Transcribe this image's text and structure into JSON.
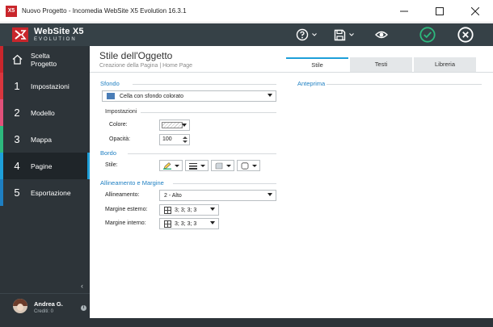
{
  "window": {
    "title": "Nuovo Progetto - Incomedia WebSite X5 Evolution 16.3.1",
    "app_icon_text": "X5"
  },
  "header": {
    "logo_line1": "WebSite X5",
    "logo_line2": "EVOLUTION",
    "accent_color": "#c9262c",
    "ok_color": "#2db87d",
    "buttons": [
      "help-icon",
      "save-icon",
      "preview-icon",
      "confirm-icon",
      "close-icon"
    ]
  },
  "sidebar": {
    "items": [
      {
        "number": "",
        "icon": "home-icon",
        "label": "Scelta Progetto",
        "label_l1": "Scelta",
        "label_l2": "Progetto",
        "color": "#c9262c"
      },
      {
        "number": "1",
        "label": "Impostazioni",
        "color": "#d9363e"
      },
      {
        "number": "2",
        "label": "Modello",
        "color": "#e0517a"
      },
      {
        "number": "3",
        "label": "Mappa",
        "color": "#2db87d"
      },
      {
        "number": "4",
        "label": "Pagine",
        "color": "#1e9fd9",
        "active": true
      },
      {
        "number": "5",
        "label": "Esportazione",
        "color": "#1e7fc2"
      }
    ],
    "user": {
      "name": "Andrea G.",
      "credits": "Crediti: 0"
    }
  },
  "page": {
    "title": "Stile dell'Oggetto",
    "subtitle": "Creazione della Pagina | Home Page"
  },
  "tabs": [
    {
      "label": "Stile",
      "active": true
    },
    {
      "label": "Testi",
      "active": false
    },
    {
      "label": "Libreria",
      "active": false
    }
  ],
  "form": {
    "sfondo": {
      "title": "Sfondo",
      "mode": "Cella con sfondo colorato",
      "impostazioni": "Impostazioni",
      "colore_label": "Colore:",
      "opacita_label": "Opacità:",
      "opacita_value": "100"
    },
    "bordo": {
      "title": "Bordo",
      "stile_label": "Stile:"
    },
    "allineamento": {
      "title": "Allineamento e Margine",
      "allineamento_label": "Allineamento:",
      "allineamento_value": "2 - Alto",
      "margine_esterno_label": "Margine esterno:",
      "margine_esterno_value": "3; 3; 3; 3",
      "margine_interno_label": "Margine interno:",
      "margine_interno_value": "3; 3; 3; 3"
    },
    "anteprima": "Anteprima"
  }
}
